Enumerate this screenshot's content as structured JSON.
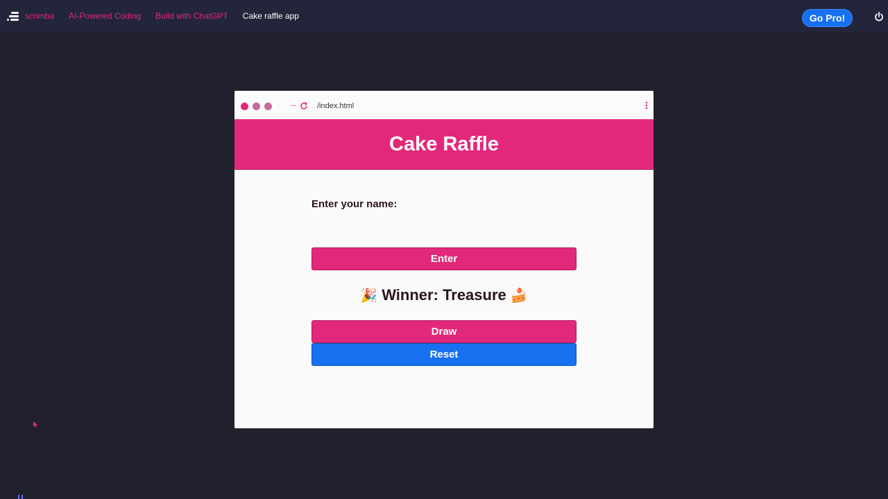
{
  "topnav": {
    "brand": "scrimba",
    "breadcrumbs": [
      "AI-Powered Coding",
      "Build with ChatGPT",
      "Cake raffle app"
    ],
    "gopro_label": "Go Pro!"
  },
  "browser": {
    "url": "/index.html"
  },
  "app": {
    "title": "Cake Raffle",
    "name_label": "Enter your name:",
    "name_value": "",
    "enter_label": "Enter",
    "winner_prefix_emoji": "🎉",
    "winner_text": "Winner: Treasure",
    "winner_suffix_emoji": "🍰",
    "draw_label": "Draw",
    "reset_label": "Reset"
  },
  "colors": {
    "accent_pink": "#e2287a",
    "accent_blue": "#1670f0",
    "background": "#20212c"
  }
}
